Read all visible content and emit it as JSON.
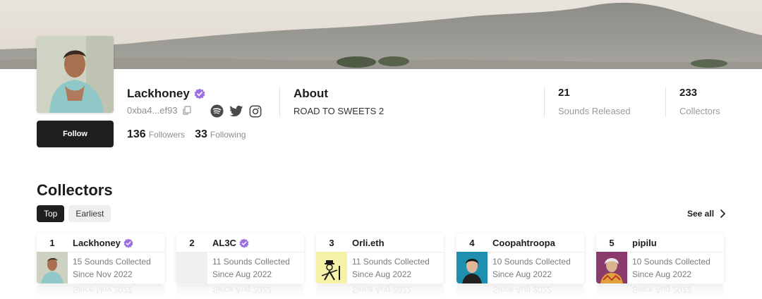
{
  "profile": {
    "name": "Lackhoney",
    "address": "0xba4...ef93",
    "follow_label": "Follow",
    "followers_count": "136",
    "followers_label": "Followers",
    "following_count": "33",
    "following_label": "Following",
    "social_icons": [
      "spotify-icon",
      "twitter-icon",
      "instagram-icon"
    ]
  },
  "about": {
    "title": "About",
    "text": "ROAD TO SWEETS 2"
  },
  "stats": [
    {
      "value": "21",
      "label": "Sounds Released"
    },
    {
      "value": "233",
      "label": "Collectors"
    }
  ],
  "collectors": {
    "title": "Collectors",
    "tabs": [
      {
        "label": "Top",
        "active": true
      },
      {
        "label": "Earliest",
        "active": false
      }
    ],
    "see_all": "See all",
    "cards": [
      {
        "rank": "1",
        "name": "Lackhoney",
        "verified": true,
        "sounds": "15 Sounds Collected",
        "since": "Since Nov 2022"
      },
      {
        "rank": "2",
        "name": "AL3C",
        "verified": true,
        "sounds": "11 Sounds Collected",
        "since": "Since Aug 2022"
      },
      {
        "rank": "3",
        "name": "Orli.eth",
        "verified": false,
        "sounds": "11 Sounds Collected",
        "since": "Since Aug 2022"
      },
      {
        "rank": "4",
        "name": "Coopahtroopa",
        "verified": false,
        "sounds": "10 Sounds Collected",
        "since": "Since Aug 2022"
      },
      {
        "rank": "5",
        "name": "pipilu",
        "verified": false,
        "sounds": "10 Sounds Collected",
        "since": "Since Aug 2022"
      }
    ]
  },
  "colors": {
    "accent_verified": "#9b6fe0",
    "button_dark": "#1f1f1f",
    "muted_text": "#8e8e8e"
  }
}
